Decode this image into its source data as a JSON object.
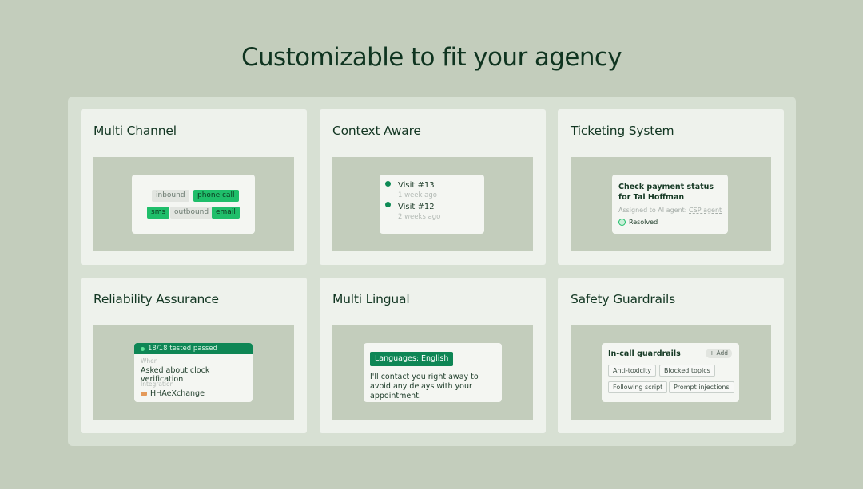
{
  "headline": "Customizable to fit your agency",
  "cards": {
    "multi_channel": {
      "title": "Multi Channel",
      "chips": [
        "inbound",
        "phone call",
        "sms",
        "outbound",
        "email"
      ]
    },
    "context_aware": {
      "title": "Context Aware",
      "visits": [
        {
          "title": "Visit #13",
          "sub": "1 week ago"
        },
        {
          "title": "Visit #12",
          "sub": "2 weeks ago"
        }
      ]
    },
    "ticketing": {
      "title": "Ticketing System",
      "ticket_line1": "Check payment status",
      "ticket_line2": "for Tal Hoffman",
      "assigned_prefix": "Assigned to AI agent: ",
      "assigned_agent": "CSP agent",
      "status": "Resolved"
    },
    "reliability": {
      "title": "Reliability Assurance",
      "header": "18/18 tested passed",
      "when_label": "When",
      "when_value": "Asked about clock verification",
      "integration_label": "Integration",
      "integration_value": "HHAeXchange"
    },
    "multi_lingual": {
      "title": "Multi Lingual",
      "badge": "Languages: English",
      "text": "I'll contact you right away to avoid any delays with your appointment."
    },
    "safety": {
      "title": "Safety Guardrails",
      "box_title": "In-call guardrails",
      "add_label": "+ Add",
      "tags": [
        "Anti-toxicity",
        "Blocked topics",
        "Following script",
        "Prompt injections"
      ]
    }
  },
  "colors": {
    "background": "#c3cdbc",
    "accent_green": "#0e8655",
    "chip_green": "#1fbe6a"
  }
}
